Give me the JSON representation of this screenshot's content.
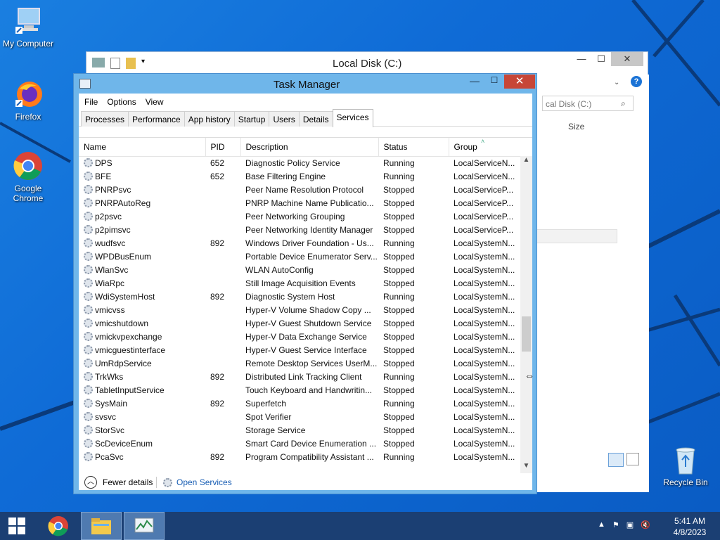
{
  "desktop": {
    "icons": [
      {
        "label": "My Computer"
      },
      {
        "label": "Firefox"
      },
      {
        "label": "Google Chrome"
      },
      {
        "label": "Recycle Bin"
      }
    ]
  },
  "explorer": {
    "title": "Local Disk (C:)",
    "search_placeholder": "cal Disk (C:)",
    "column_size": "Size",
    "help": "?"
  },
  "task_manager": {
    "title": "Task Manager",
    "menu": [
      "File",
      "Options",
      "View"
    ],
    "tabs": [
      "Processes",
      "Performance",
      "App history",
      "Startup",
      "Users",
      "Details",
      "Services"
    ],
    "active_tab": "Services",
    "columns": [
      "Name",
      "PID",
      "Description",
      "Status",
      "Group"
    ],
    "rows": [
      [
        "DPS",
        "652",
        "Diagnostic Policy Service",
        "Running",
        "LocalServiceN..."
      ],
      [
        "BFE",
        "652",
        "Base Filtering Engine",
        "Running",
        "LocalServiceN..."
      ],
      [
        "PNRPsvc",
        "",
        "Peer Name Resolution Protocol",
        "Stopped",
        "LocalServiceP..."
      ],
      [
        "PNRPAutoReg",
        "",
        "PNRP Machine Name Publicatio...",
        "Stopped",
        "LocalServiceP..."
      ],
      [
        "p2psvc",
        "",
        "Peer Networking Grouping",
        "Stopped",
        "LocalServiceP..."
      ],
      [
        "p2pimsvc",
        "",
        "Peer Networking Identity Manager",
        "Stopped",
        "LocalServiceP..."
      ],
      [
        "wudfsvc",
        "892",
        "Windows Driver Foundation - Us...",
        "Running",
        "LocalSystemN..."
      ],
      [
        "WPDBusEnum",
        "",
        "Portable Device Enumerator Serv...",
        "Stopped",
        "LocalSystemN..."
      ],
      [
        "WlanSvc",
        "",
        "WLAN AutoConfig",
        "Stopped",
        "LocalSystemN..."
      ],
      [
        "WiaRpc",
        "",
        "Still Image Acquisition Events",
        "Stopped",
        "LocalSystemN..."
      ],
      [
        "WdiSystemHost",
        "892",
        "Diagnostic System Host",
        "Running",
        "LocalSystemN..."
      ],
      [
        "vmicvss",
        "",
        "Hyper-V Volume Shadow Copy ...",
        "Stopped",
        "LocalSystemN..."
      ],
      [
        "vmicshutdown",
        "",
        "Hyper-V Guest Shutdown Service",
        "Stopped",
        "LocalSystemN..."
      ],
      [
        "vmickvpexchange",
        "",
        "Hyper-V Data Exchange Service",
        "Stopped",
        "LocalSystemN..."
      ],
      [
        "vmicguestinterface",
        "",
        "Hyper-V Guest Service Interface",
        "Stopped",
        "LocalSystemN..."
      ],
      [
        "UmRdpService",
        "",
        "Remote Desktop Services UserM...",
        "Stopped",
        "LocalSystemN..."
      ],
      [
        "TrkWks",
        "892",
        "Distributed Link Tracking Client",
        "Running",
        "LocalSystemN..."
      ],
      [
        "TabletInputService",
        "",
        "Touch Keyboard and Handwritin...",
        "Stopped",
        "LocalSystemN..."
      ],
      [
        "SysMain",
        "892",
        "Superfetch",
        "Running",
        "LocalSystemN..."
      ],
      [
        "svsvc",
        "",
        "Spot Verifier",
        "Stopped",
        "LocalSystemN..."
      ],
      [
        "StorSvc",
        "",
        "Storage Service",
        "Stopped",
        "LocalSystemN..."
      ],
      [
        "ScDeviceEnum",
        "",
        "Smart Card Device Enumeration ...",
        "Stopped",
        "LocalSystemN..."
      ],
      [
        "PcaSvc",
        "892",
        "Program Compatibility Assistant ...",
        "Running",
        "LocalSystemN..."
      ]
    ],
    "fewer_details": "Fewer details",
    "open_services": "Open Services"
  },
  "taskbar": {
    "time": "5:41 AM",
    "date": "4/8/2023"
  }
}
